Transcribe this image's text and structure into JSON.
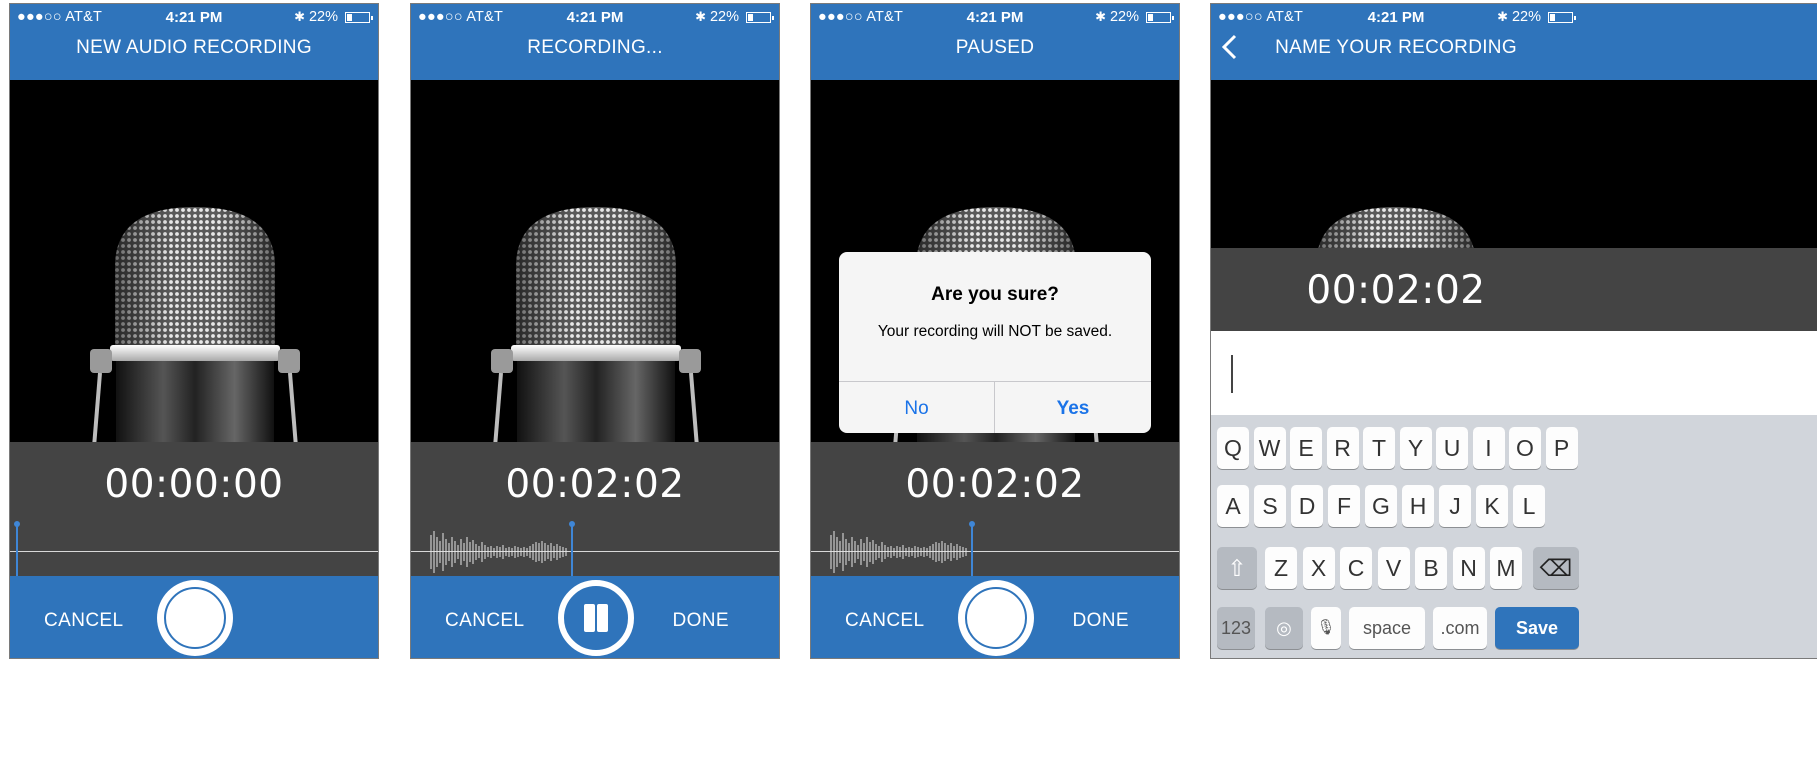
{
  "status": {
    "carrier": "●●●○○ AT&T",
    "time": "4:21 PM",
    "battery": "22%"
  },
  "screens": {
    "new": {
      "title": "NEW AUDIO RECORDING",
      "timer": "00:00:00",
      "cancel": "CANCEL"
    },
    "recording": {
      "title": "RECORDING...",
      "timer": "00:02:02",
      "cancel": "CANCEL",
      "done": "DONE"
    },
    "paused": {
      "title": "PAUSED",
      "timer": "00:02:02",
      "cancel": "CANCEL",
      "done": "DONE",
      "alert": {
        "title": "Are you sure?",
        "message": "Your recording will NOT be saved.",
        "no": "No",
        "yes": "Yes"
      }
    },
    "name": {
      "title": "NAME YOUR RECORDING",
      "timer": "00:02:02"
    }
  },
  "keyboard": {
    "row1": [
      "Q",
      "W",
      "E",
      "R",
      "T",
      "Y",
      "U",
      "I",
      "O",
      "P"
    ],
    "row2": [
      "A",
      "S",
      "D",
      "F",
      "G",
      "H",
      "J",
      "K",
      "L"
    ],
    "row3": [
      "Z",
      "X",
      "C",
      "V",
      "B",
      "N",
      "M"
    ],
    "numbers": "123",
    "space": "space",
    "dotcom": ".com",
    "save": "Save"
  },
  "colors": {
    "brand_blue": "#2f74bb",
    "panel_gray": "#444444",
    "link_blue": "#1a73e8"
  },
  "icons": [
    "wifi-icon",
    "bluetooth-icon",
    "battery-icon",
    "microphone-image",
    "record-icon",
    "pause-icon",
    "back-chevron-icon",
    "shift-icon",
    "delete-icon",
    "globe-icon",
    "dictation-icon"
  ]
}
